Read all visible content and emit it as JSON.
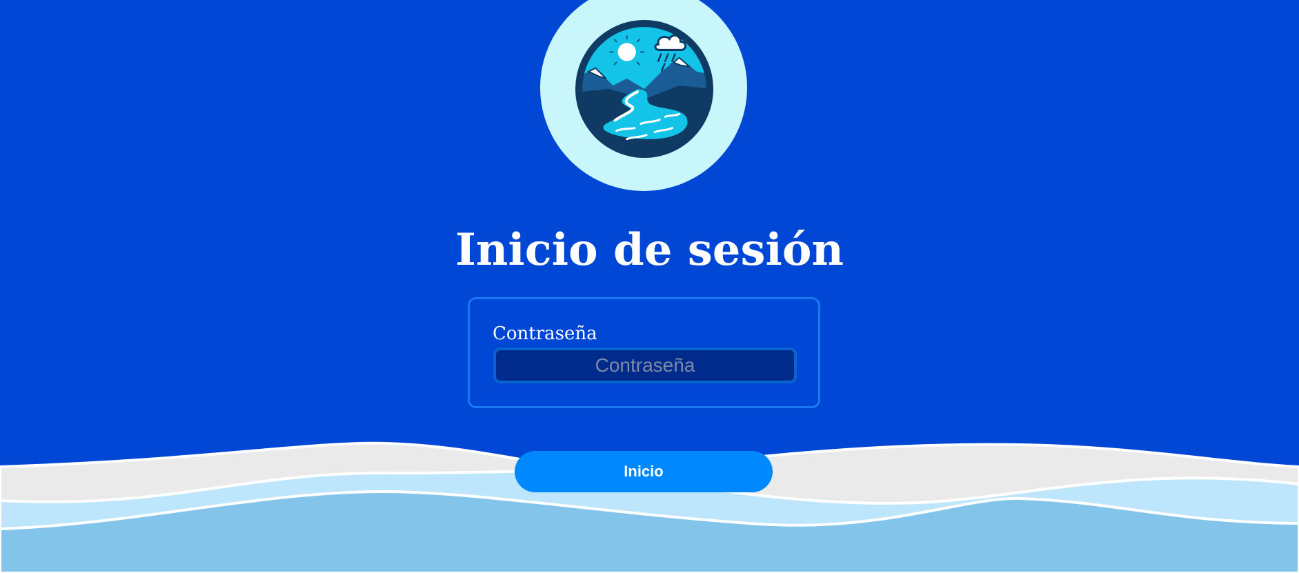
{
  "page": {
    "title": "Inicio de sesión"
  },
  "logo": {
    "icon": "river-mountains-logo-icon"
  },
  "form": {
    "password_label": "Contraseña",
    "password_placeholder": "Contraseña",
    "password_value": ""
  },
  "actions": {
    "login_label": "Inicio"
  },
  "colors": {
    "background": "#0047d6",
    "logo_backdrop": "#c8f6fb",
    "form_border": "#1a7af0",
    "input_background": "#002b8c",
    "button": "#0088ff",
    "wave_grey": "#eaeaea",
    "wave_light_blue": "#bde6fc",
    "wave_blue": "#82c4ea"
  }
}
